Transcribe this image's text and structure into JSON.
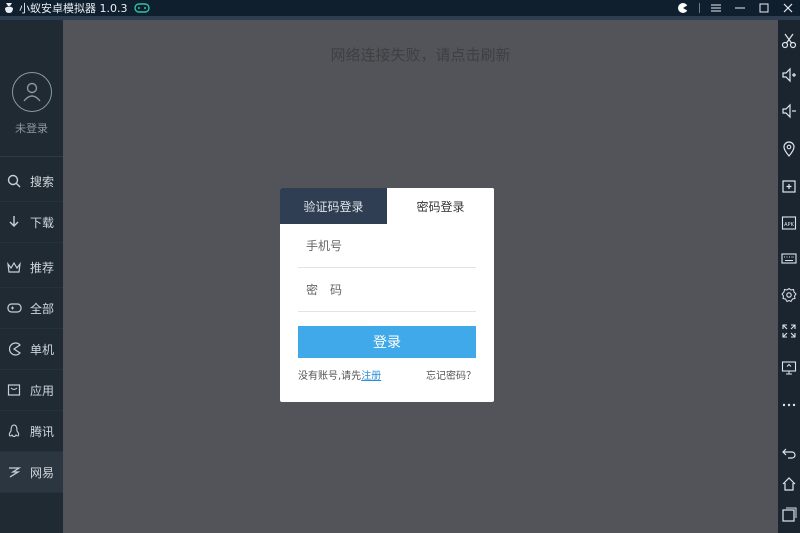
{
  "titlebar": {
    "title": "小蚁安卓模拟器 1.0.3"
  },
  "sidebar": {
    "user_status": "未登录",
    "items": [
      {
        "label": "搜索",
        "icon": "search-icon"
      },
      {
        "label": "下载",
        "icon": "download-icon"
      },
      {
        "label": "推荐",
        "icon": "crown-icon"
      },
      {
        "label": "全部",
        "icon": "gamepad-icon"
      },
      {
        "label": "单机",
        "icon": "pacman-icon"
      },
      {
        "label": "应用",
        "icon": "app-box-icon"
      },
      {
        "label": "腾讯",
        "icon": "penguin-icon"
      },
      {
        "label": "网易",
        "icon": "netease-icon"
      }
    ]
  },
  "main": {
    "error_text": "网络连接失败，请点击刷新"
  },
  "login_dialog": {
    "tabs": [
      {
        "label": "验证码登录"
      },
      {
        "label": "密码登录"
      }
    ],
    "phone_placeholder": "手机号",
    "password_placeholder": "密　码",
    "login_button": "登录",
    "no_account_text": "没有账号,请先",
    "register_link": "注册",
    "forgot_password": "忘记密码？"
  },
  "colors": {
    "accent": "#3fa9e9",
    "sidebar_bg": "#1f2a33",
    "main_bg": "#525459"
  }
}
